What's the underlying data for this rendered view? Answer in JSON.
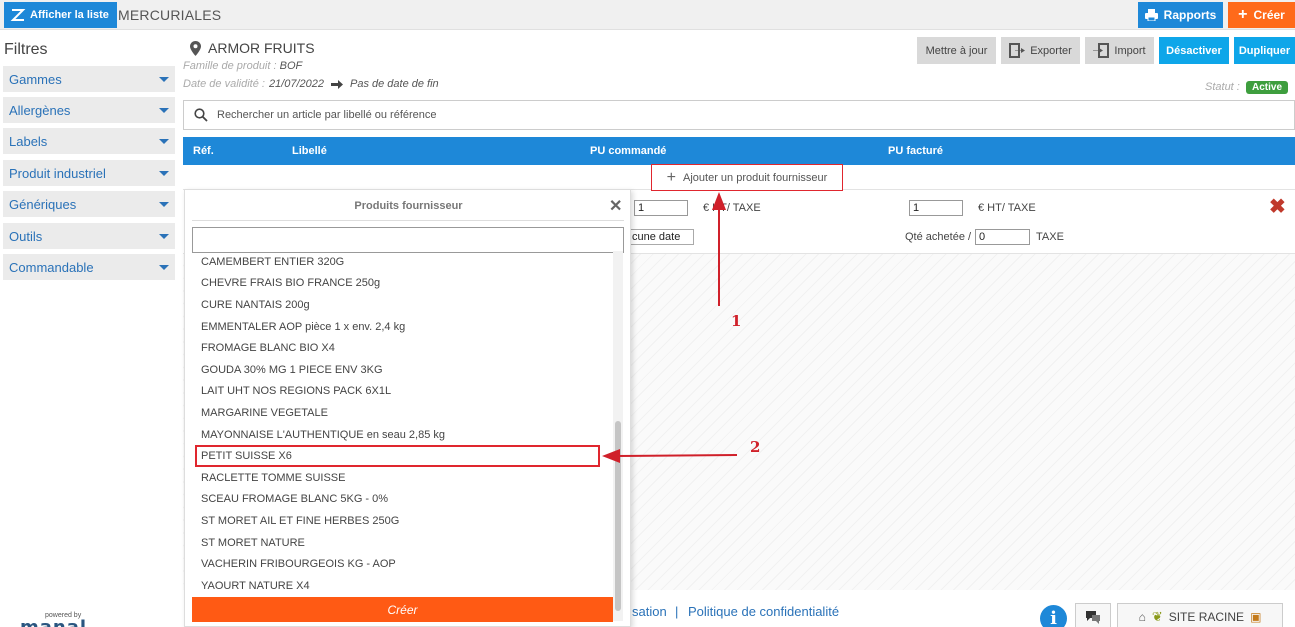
{
  "topbar": {
    "list_button": "Afficher la liste",
    "app_title": "MERCURIALES",
    "reports_button": "Rapports",
    "create_button": "Créer"
  },
  "filters": {
    "title": "Filtres",
    "items": [
      "Gammes",
      "Allergènes",
      "Labels",
      "Produit industriel",
      "Génériques",
      "Outils",
      "Commandable"
    ]
  },
  "supplier": {
    "name": "ARMOR FRUITS",
    "family_label": "Famille de produit :",
    "family_value": "BOF",
    "validity_label": "Date de validité :",
    "validity_value": "21/07/2022",
    "end_date": "Pas de date de fin"
  },
  "actions": {
    "update": "Mettre à jour",
    "export": "Exporter",
    "import": "Import",
    "deactivate": "Désactiver",
    "duplicate": "Dupliquer"
  },
  "status": {
    "label": "Statut :",
    "value": "Active"
  },
  "search": {
    "placeholder": "Rechercher un article par libellé ou référence"
  },
  "table": {
    "headers": {
      "ref": "Réf.",
      "label": "Libellé",
      "pu_ordered": "PU commandé",
      "pu_invoiced": "PU facturé"
    },
    "add_product": "Ajouter un produit fournisseur",
    "row": {
      "qty_ordered": "1",
      "unit_ordered": "€ HT/ TAXE",
      "qty_invoiced": "1",
      "unit_invoiced": "€ HT/ TAXE",
      "date_placeholder": "cune date",
      "qty_bought_label": "Qté achetée /",
      "qty_bought": "0",
      "tax_label": "TAXE"
    }
  },
  "popup": {
    "title": "Produits fournisseur",
    "items": [
      "CAMEMBERT ENTIER 320G",
      "CHEVRE FRAIS BIO FRANCE 250g",
      "CURE NANTAIS 200g",
      "EMMENTALER AOP pièce 1 x env. 2,4 kg",
      "FROMAGE BLANC BIO X4",
      "GOUDA 30% MG 1 PIECE ENV 3KG",
      "LAIT UHT NOS REGIONS PACK 6X1L",
      "MARGARINE VEGETALE",
      "MAYONNAISE L'AUTHENTIQUE en seau 2,85 kg",
      "PETIT SUISSE X6",
      "RACLETTE TOMME SUISSE",
      "SCEAU FROMAGE BLANC 5KG - 0%",
      "ST MORET AIL ET FINE HERBES 250G",
      "ST MORET NATURE",
      "VACHERIN FRIBOURGEOIS KG - AOP",
      "YAOURT NATURE X4"
    ],
    "create_button": "Créer"
  },
  "annotations": {
    "one": "1",
    "two": "2"
  },
  "footer": {
    "link_partial": "sation",
    "sep": "|",
    "privacy": "Politique de confidentialité",
    "powered_by": "powered by",
    "logo": "manal",
    "site_root": "SITE RACINE"
  },
  "colors": {
    "primary": "#1e88d8",
    "accent": "#ff6a1a",
    "annotation": "#e0262e",
    "active": "#3e9e3e"
  }
}
